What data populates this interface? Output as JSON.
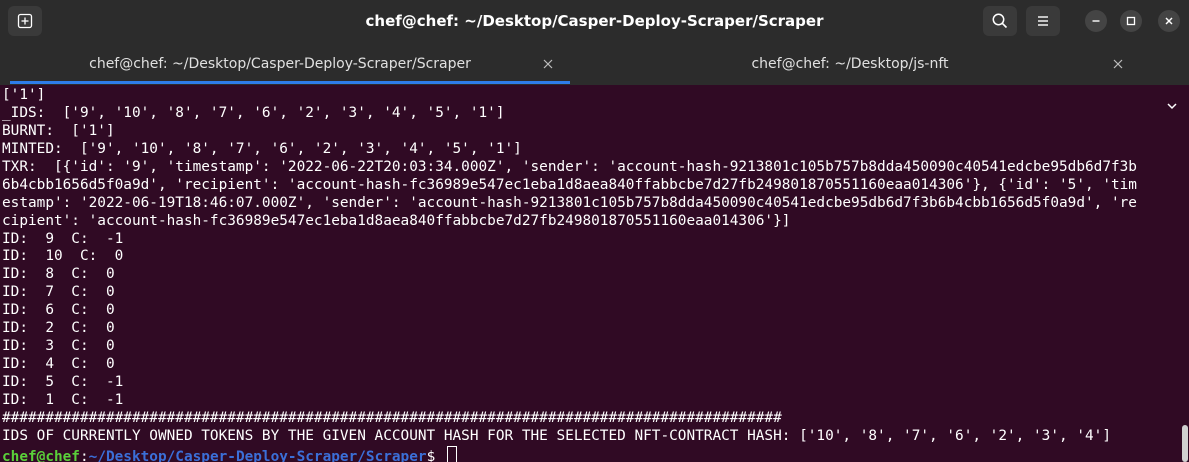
{
  "window": {
    "title": "chef@chef: ~/Desktop/Casper-Deploy-Scraper/Scraper"
  },
  "header": {
    "icons": [
      "new-tab-icon",
      "search-icon",
      "hamburger-menu-icon",
      "minimize-icon",
      "maximize-icon",
      "close-icon"
    ]
  },
  "tabs": [
    {
      "label": "chef@chef: ~/Desktop/Casper-Deploy-Scraper/Scraper",
      "active": true
    },
    {
      "label": "chef@chef: ~/Desktop/js-nft",
      "active": false
    }
  ],
  "colors": {
    "terminal_bg": "#300a24",
    "headerbar_bg": "#2c2c2c",
    "tab_indicator": "#2e7de9",
    "prompt_user": "#5ad03a",
    "prompt_path": "#3b6fd8"
  },
  "terminal": {
    "lines": [
      "['1']",
      "_IDS:  ['9', '10', '8', '7', '6', '2', '3', '4', '5', '1']",
      "BURNT:  ['1']",
      "MINTED:  ['9', '10', '8', '7', '6', '2', '3', '4', '5', '1']",
      "TXR:  [{'id': '9', 'timestamp': '2022-06-22T20:03:34.000Z', 'sender': 'account-hash-9213801c105b757b8dda450090c40541edcbe95db6d7f3b",
      "6b4cbb1656d5f0a9d', 'recipient': 'account-hash-fc36989e547ec1eba1d8aea840ffabbcbe7d27fb249801870551160eaa014306'}, {'id': '5', 'tim",
      "estamp': '2022-06-19T18:46:07.000Z', 'sender': 'account-hash-9213801c105b757b8dda450090c40541edcbe95db6d7f3b6b4cbb1656d5f0a9d', 're",
      "cipient': 'account-hash-fc36989e547ec1eba1d8aea840ffabbcbe7d27fb249801870551160eaa014306'}]",
      "ID:  9  C:  -1",
      "ID:  10  C:  0",
      "ID:  8  C:  0",
      "ID:  7  C:  0",
      "ID:  6  C:  0",
      "ID:  2  C:  0",
      "ID:  3  C:  0",
      "ID:  4  C:  0",
      "ID:  5  C:  -1",
      "ID:  1  C:  -1",
      "##########################################################################################",
      "IDS OF CURRENTLY OWNED TOKENS BY THE GIVEN ACCOUNT HASH FOR THE SELECTED NFT-CONTRACT HASH: ['10', '8', '7', '6', '2', '3', '4']"
    ],
    "prompt": {
      "user": "chef@chef",
      "separator": ":",
      "path": "~/Desktop/Casper-Deploy-Scraper/Scraper",
      "symbol": "$ "
    }
  }
}
